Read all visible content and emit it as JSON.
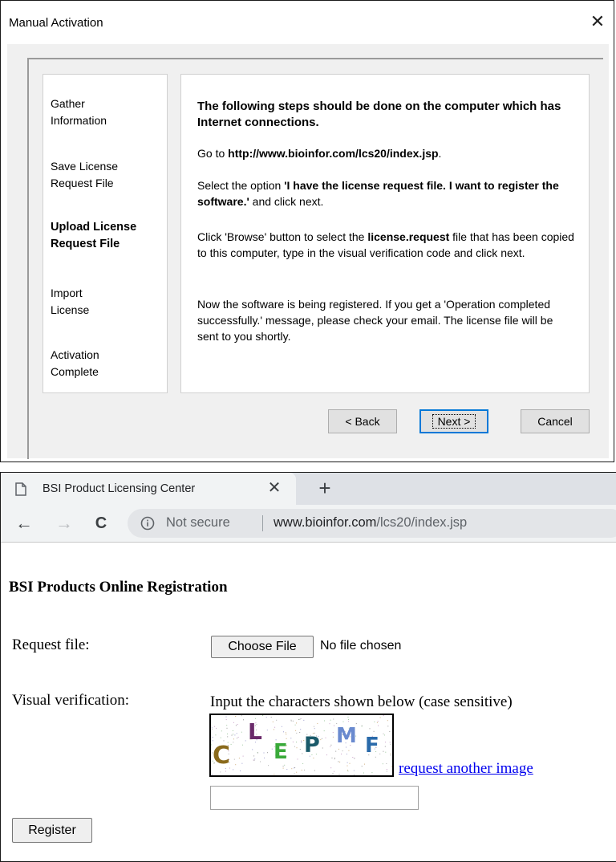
{
  "dialog": {
    "title": "Manual Activation",
    "close_glyph": "✕",
    "steps": [
      {
        "line1": "Gather",
        "line2": "Information",
        "active": false
      },
      {
        "line1": "Save License",
        "line2": "Request File",
        "active": false
      },
      {
        "line1": "Upload License",
        "line2": "Request File",
        "active": true
      },
      {
        "line1": "Import",
        "line2": "License",
        "active": false
      },
      {
        "line1": "Activation",
        "line2": "Complete",
        "active": false
      }
    ],
    "content": {
      "heading": "The following steps should be done on the computer which has Internet connections.",
      "goto_prefix": "Go to ",
      "goto_url": "http://www.bioinfor.com/lcs20/index.jsp",
      "goto_suffix": ".",
      "select_prefix": "Select the option ",
      "select_option": "'I have the license request file. I want to register the software.'",
      "select_suffix": " and click next.",
      "browse_prefix": "Click 'Browse' button to select the ",
      "browse_file": "license.request",
      "browse_suffix": " file that has been copied to this computer, type in the visual verification code and click next.",
      "registered_text": "Now the software is being registered. If you get a 'Operation completed successfully.' message, please check your email. The license file will be sent to you shortly."
    },
    "buttons": {
      "back": "< Back",
      "next": "Next >",
      "cancel": "Cancel"
    }
  },
  "browser": {
    "tab": {
      "title": "BSI Product Licensing Center",
      "close_glyph": "✕",
      "icon": "page-icon"
    },
    "new_tab_glyph": "+",
    "nav": {
      "back_glyph": "←",
      "forward_glyph": "→",
      "reload_glyph": "C"
    },
    "address": {
      "security": "Not secure",
      "host": "www.bioinfor.com",
      "path": "/lcs20/index.jsp"
    },
    "page": {
      "heading": "BSI Products Online Registration",
      "request_label": "Request file:",
      "choose_file": "Choose File",
      "file_status": "No file chosen",
      "visual_label": "Visual verification:",
      "instructions": "Input the characters shown below (case sensitive)",
      "captcha_letters": [
        {
          "char": "C",
          "color": "#8a6a1c"
        },
        {
          "char": "L",
          "color": "#6a2a6a"
        },
        {
          "char": "E",
          "color": "#3aaa3a"
        },
        {
          "char": "P",
          "color": "#1a5a6a"
        },
        {
          "char": "M",
          "color": "#6a8acf"
        },
        {
          "char": "F",
          "color": "#2a6aaa"
        }
      ],
      "request_another": "request another image",
      "code_value": "",
      "register": "Register"
    }
  }
}
